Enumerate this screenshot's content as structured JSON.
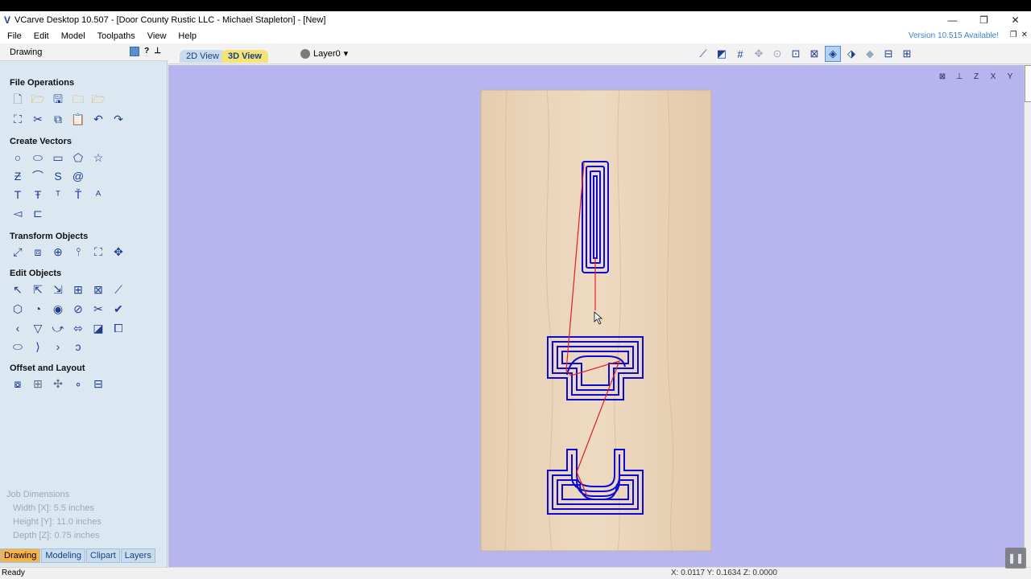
{
  "window": {
    "title": "VCarve Desktop 10.507 - [Door County Rustic LLC - Michael Stapleton] - [New]",
    "controls": {
      "minimize": "—",
      "restore": "❐",
      "close": "✕"
    }
  },
  "menu": {
    "items": [
      "File",
      "Edit",
      "Model",
      "Toolpaths",
      "View",
      "Help"
    ],
    "version_notice": "Version 10.515 Available!"
  },
  "panel": {
    "header": "Drawing",
    "sections": {
      "file_operations": "File Operations",
      "create_vectors": "Create Vectors",
      "transform_objects": "Transform Objects",
      "edit_objects": "Edit Objects",
      "offset_layout": "Offset and Layout"
    },
    "job": {
      "title": "Job Dimensions",
      "width": "Width  [X]: 5.5 inches",
      "height": "Height [Y]: 11.0 inches",
      "depth": "Depth  [Z]: 0.75 inches"
    },
    "tabs": [
      "Drawing",
      "Modeling",
      "Clipart",
      "Layers"
    ]
  },
  "viewbar": {
    "tab_2d": "2D View",
    "tab_3d": "3D View",
    "layer": "Layer0"
  },
  "viewport": {
    "background": "#b6b5ef",
    "wood_color": "#e8cfb3",
    "toolpath_color": "#0a0ad6",
    "rapid_color": "#e02020",
    "axes": [
      "⊠",
      "⊥",
      "Z",
      "X",
      "Y"
    ]
  },
  "status": {
    "ready": "Ready",
    "coords": "X: 0.0117 Y: 0.1634 Z: 0.0000"
  }
}
